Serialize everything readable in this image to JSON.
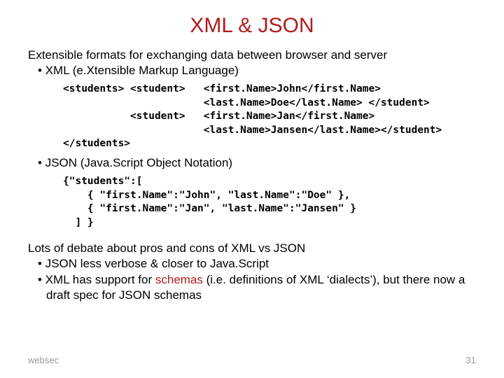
{
  "title": "XML & JSON",
  "intro": "Extensible formats for exchanging data between browser and server",
  "bullet_xml": "XML (e.Xtensible Markup Language)",
  "xml_code": "<students> <student>   <first.Name>John</first.Name>\n                       <last.Name>Doe</last.Name> </student>\n           <student>   <first.Name>Jan</first.Name>\n                       <last.Name>Jansen</last.Name></student>\n</students>",
  "bullet_json": "JSON (Java.Script Object Notation)",
  "json_code": "{\"students\":[\n    { \"first.Name\":\"John\", \"last.Name\":\"Doe\" },\n    { \"first.Name\":\"Jan\", \"last.Name\":\"Jansen\" }\n  ] }",
  "debate": "Lots of debate about pros and cons of XML vs JSON",
  "pro_json": "JSON less verbose & closer to Java.Script",
  "pro_xml_a": "XML has support for ",
  "pro_xml_schemas": "schemas",
  "pro_xml_b": " (i.e. definitions of XML ‘dialects’), but there now a draft spec for JSON schemas",
  "footer_left": "websec",
  "footer_right": "31"
}
